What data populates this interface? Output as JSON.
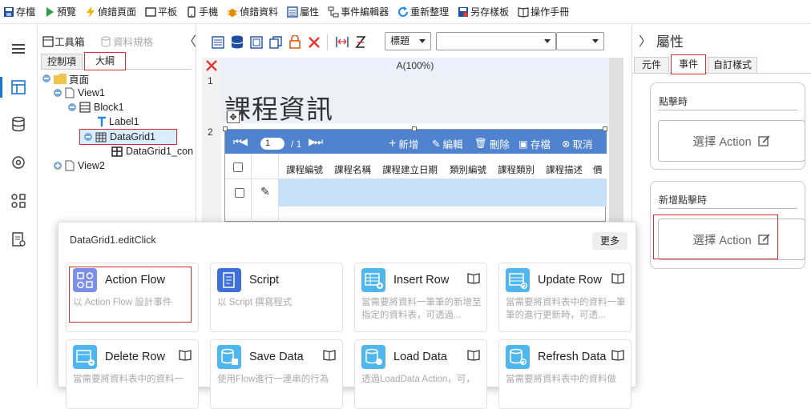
{
  "toolbar": {
    "items": [
      {
        "label": "存檔",
        "icon": "save-icon"
      },
      {
        "label": "預覽",
        "icon": "play-icon"
      },
      {
        "label": "偵錯頁面",
        "icon": "bolt-icon"
      },
      {
        "label": "平板",
        "icon": "tablet-icon"
      },
      {
        "label": "手機",
        "icon": "phone-icon"
      },
      {
        "label": "偵錯資料",
        "icon": "bug-icon"
      },
      {
        "label": "屬性",
        "icon": "properties-icon"
      },
      {
        "label": "事件編輯器",
        "icon": "event-editor-icon"
      },
      {
        "label": "重新整理",
        "icon": "refresh-icon"
      },
      {
        "label": "另存樣板",
        "icon": "save-as-icon"
      },
      {
        "label": "操作手冊",
        "icon": "manual-icon"
      }
    ]
  },
  "tree_panel": {
    "toolbox_label": "工具箱",
    "data_spec_label": "資料規格",
    "tabs": [
      "控制項",
      "大綱"
    ],
    "active_tab": "大綱",
    "nodes": [
      "頁面",
      "View1",
      "Block1",
      "Label1",
      "DataGrid1",
      "DataGrid1_con",
      "View2"
    ]
  },
  "designer": {
    "heading_select": "標題",
    "column_header": "A(100%)",
    "row_numbers": [
      "1",
      "2"
    ],
    "page_title": "課程資訊",
    "grid": {
      "page_value": "1",
      "page_total": "/ 1",
      "actions": [
        "新增",
        "編輯",
        "刪除",
        "存檔",
        "取消"
      ],
      "columns": [
        "課程編號",
        "課程名稱",
        "課程建立日期",
        "類別編號",
        "課程類別",
        "課程描述",
        "價"
      ]
    }
  },
  "props": {
    "title": "屬性",
    "tabs": [
      "元件",
      "事件",
      "自訂樣式"
    ],
    "active_tab": "事件",
    "sections": [
      {
        "label": "點擊時",
        "button": "選擇 Action"
      },
      {
        "label": "新增點擊時",
        "button": "選擇 Action"
      }
    ]
  },
  "popup": {
    "title": "DataGrid1.editClick",
    "more_label": "更多",
    "actions": [
      {
        "title": "Action Flow",
        "desc": "以 Action Flow 設計事件",
        "color": "#7b8fe8"
      },
      {
        "title": "Script",
        "desc": "以 Script 撰寫程式",
        "color": "#3f6fd8"
      },
      {
        "title": "Insert Row",
        "desc": "當需要將資料一筆筆的新增至指定的資料表，可透過...",
        "color": "#4fb6ee"
      },
      {
        "title": "Update Row",
        "desc": "當需要將資料表中的資料一筆筆的進行更新時，可透...",
        "color": "#4fb6ee"
      },
      {
        "title": "Delete Row",
        "desc": "當需要將資料表中的資料一",
        "color": "#4fb6ee"
      },
      {
        "title": "Save Data",
        "desc": "使用Flow進行一連串的行為",
        "color": "#4fb6ee"
      },
      {
        "title": "Load Data",
        "desc": "透過LoadData Action，可，",
        "color": "#4fb6ee"
      },
      {
        "title": "Refresh Data",
        "desc": "當需要將資料表中的資料做",
        "color": "#4fb6ee"
      }
    ]
  }
}
